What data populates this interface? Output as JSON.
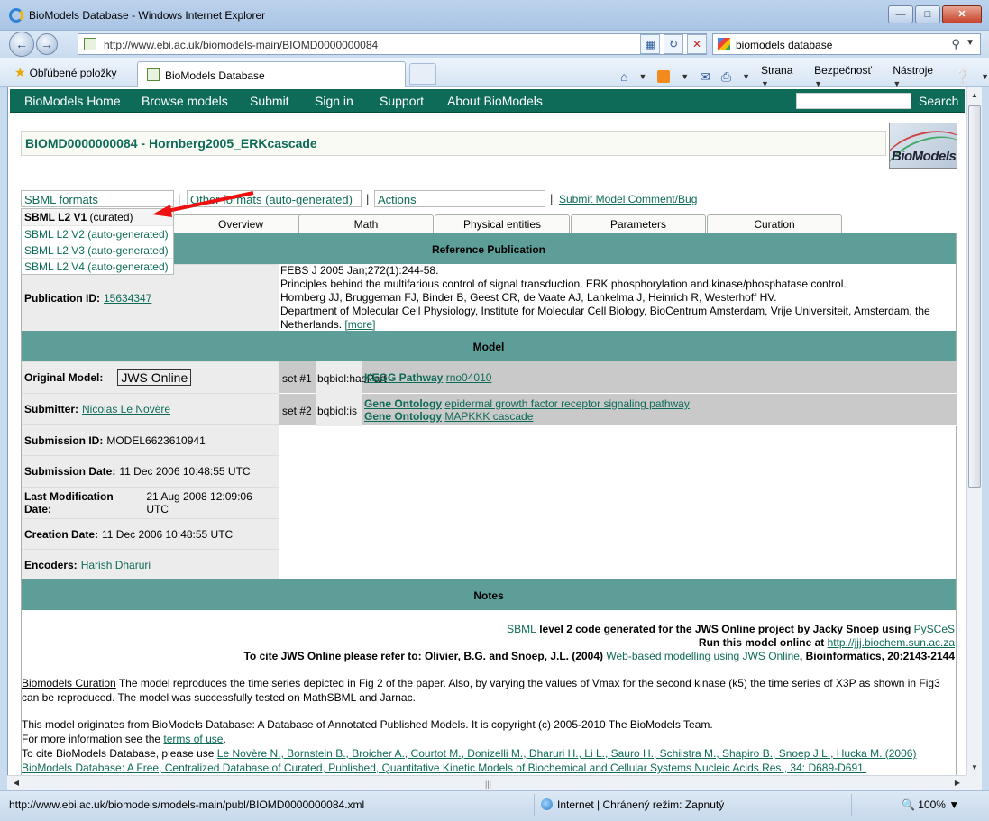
{
  "browser": {
    "window_title": "BioModels Database - Windows Internet Explorer",
    "address_url": "http://www.ebi.ac.uk/biomodels-main/BIOMD0000000084",
    "search_query": "biomodels database",
    "favorites_label": "Obľúbené položky",
    "tab_title": "BioModels Database",
    "cmd_page": "Strana",
    "cmd_safety": "Bezpečnosť",
    "cmd_tools": "Nástroje",
    "status_url": "http://www.ebi.ac.uk/biomodels/models-main/publ/BIOMD0000000084.xml",
    "status_zone": "Internet | Chránený režim: Zapnutý",
    "zoom": "100%"
  },
  "menu": {
    "items": [
      "BioModels Home",
      "Browse models",
      "Submit",
      "Sign in",
      "Support",
      "About BioModels"
    ],
    "search_button": "Search"
  },
  "model": {
    "title": "BIOMD0000000084 - Hornberg2005_ERKcascade",
    "logo_text": "BioModels"
  },
  "formats": {
    "sbml_label": "SBML formats",
    "other_label": "Other formats (auto-generated)",
    "actions_label": "Actions",
    "separator": "|",
    "submit_comment": "Submit Model Comment/Bug",
    "dropdown": {
      "selected_bold": "SBML L2 V1",
      "selected_rest": " (curated)",
      "options": [
        "SBML L2 V2 (auto-generated)",
        "SBML L2 V3 (auto-generated)",
        "SBML L2 V4 (auto-generated)"
      ]
    }
  },
  "tabs": [
    "Overview",
    "Math",
    "Physical entities",
    "Parameters",
    "Curation"
  ],
  "reference": {
    "header": "Reference Publication",
    "pubid_label": "Publication ID:",
    "pubid_value": "15634347",
    "journal": "FEBS J 2005 Jan;272(1):244-58.",
    "title": "Principles behind the multifarious control of signal transduction. ERK phosphorylation and kinase/phosphatase control.",
    "authors": "Hornberg JJ, Bruggeman FJ, Binder B, Geest CR, de Vaate AJ, Lankelma J, Heinrich R, Westerhoff HV.",
    "affiliation": "Department of Molecular Cell Physiology, Institute for Molecular Cell Biology, BioCentrum Amsterdam, Vrije Universiteit, Amsterdam, the Netherlands.",
    "more": "[more]"
  },
  "model_section": {
    "header": "Model",
    "original_label": "Original Model:",
    "original_value": "JWS Online",
    "submitter_label": "Submitter:",
    "submitter_value": "Nicolas Le Novère",
    "submission_id_label": "Submission ID:",
    "submission_id_value": "MODEL6623610941",
    "submission_date_label": "Submission Date:",
    "submission_date_value": "11 Dec 2006 10:48:55 UTC",
    "lastmod_label": "Last Modification Date:",
    "lastmod_value": "21 Aug 2008 12:09:06 UTC",
    "creation_label": "Creation Date:",
    "creation_value": "11 Dec 2006 10:48:55 UTC",
    "encoders_label": "Encoders:",
    "encoders_value": "Harish Dharuri",
    "annotations": [
      {
        "set": "set #1",
        "predicate": "bqbiol:hasPart",
        "links": [
          {
            "db": "KEGG Pathway",
            "term": "rno04010"
          }
        ]
      },
      {
        "set": "set #2",
        "predicate": "bqbiol:is",
        "links": [
          {
            "db": "Gene Ontology",
            "term": "epidermal growth factor receptor signaling pathway"
          },
          {
            "db": "Gene Ontology",
            "term": "MAPKKK cascade"
          }
        ]
      }
    ]
  },
  "notes": {
    "header": "Notes",
    "line1_link": "SBML",
    "line1_text": " level 2 code generated for the JWS Online project by Jacky Snoep using ",
    "line1_link2": "PySCeS",
    "line2_text": "Run this model online at ",
    "line2_link": "http://jjj.biochem.sun.ac.za",
    "line3_text": "To cite JWS Online please refer to: Olivier, B.G. and Snoep, J.L. (2004) ",
    "line3_link": "Web-based modelling using JWS Online",
    "line3_end": ", Bioinformatics, 20:2143-2144",
    "curation_label": "Biomodels Curation",
    "curation_text": " The model reproduces the time series depicted in Fig 2 of the paper. Also, by varying the values of Vmax for the second kinase (k5) the time series of X3P as shown in Fig3 can be reproduced. The model was successfully tested on MathSBML and Jarnac.",
    "origin_text": "This model originates from BioModels Database: A Database of Annotated Published Models. It is copyright (c) 2005-2010 The BioModels Team.",
    "more_info": "For more information see the ",
    "terms_link": "terms of use",
    "terms_end": ".",
    "cite_text": "To cite BioModels Database, please use ",
    "cite_link": "Le Novère N., Bornstein B., Broicher A., Courtot M., Donizelli M., Dharuri H., Li L., Sauro H., Schilstra M., Shapiro B., Snoep J.L., Hucka M. (2006) BioModels Database: A Free, Centralized Database of Curated, Published, Quantitative Kinetic Models of Biochemical and Cellular Systems Nucleic Acids Res., 34: D689-D691."
  }
}
